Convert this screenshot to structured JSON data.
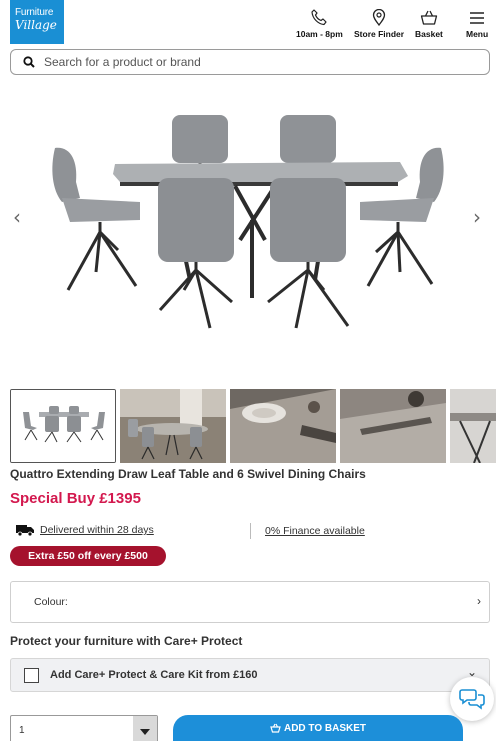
{
  "brand": {
    "logo_line1": "Furniture",
    "logo_line2": "Village"
  },
  "header": {
    "phone": {
      "label": "10am - 8pm",
      "icon": "phone-icon"
    },
    "store": {
      "label": "Store Finder",
      "icon": "location-pin-icon"
    },
    "basket": {
      "label": "Basket",
      "icon": "basket-icon"
    },
    "menu": {
      "label": "Menu",
      "icon": "hamburger-icon"
    }
  },
  "search": {
    "placeholder": "Search for a product or brand",
    "icon": "search-icon"
  },
  "gallery": {
    "prev_icon": "chevron-left-icon",
    "next_icon": "chevron-right-icon",
    "thumbnail_count": 5,
    "active_thumbnail": 1
  },
  "product": {
    "title": "Quattro Extending Draw Leaf Table and 6 Swivel Dining Chairs",
    "price": "Special Buy £1395"
  },
  "info": {
    "delivery": "Delivered within 28 days",
    "finance": "0% Finance available",
    "promo": "Extra £50 off every £500"
  },
  "colour": {
    "label": "Colour:"
  },
  "protect": {
    "heading": "Protect your furniture with Care+ Protect",
    "option": "Add Care+ Protect & Care Kit from £160"
  },
  "purchase": {
    "quantity": "1",
    "add_to_basket": "ADD TO BASKET"
  },
  "colors": {
    "brand_blue": "#1a8fd4",
    "price_pink": "#d3184e",
    "promo_red": "#a5122d",
    "button_blue": "#1d8fd9"
  }
}
